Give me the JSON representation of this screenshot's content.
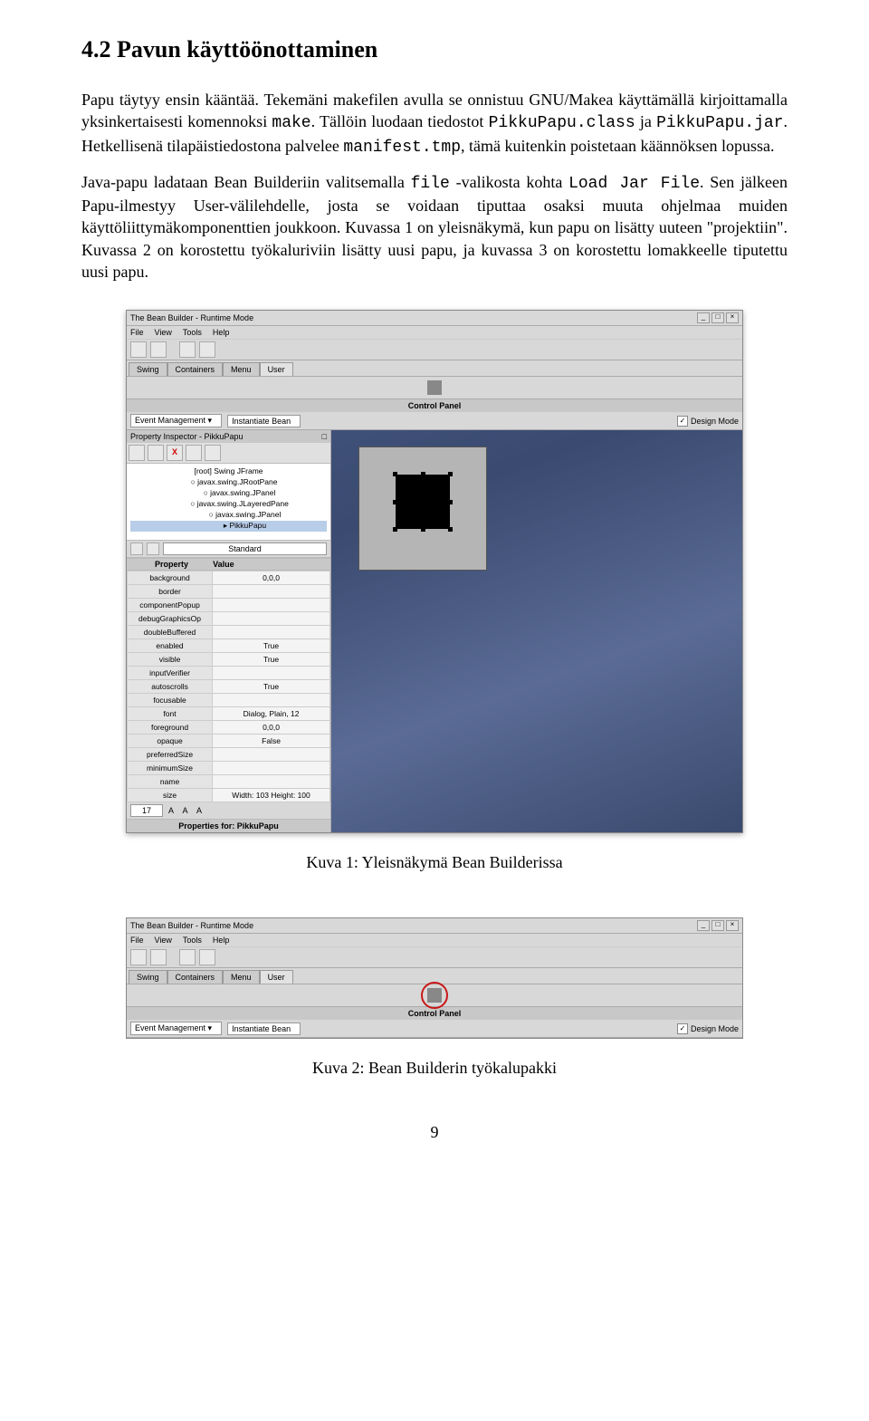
{
  "heading": "4.2   Pavun käyttöönottaminen",
  "para1_pre": "Papu täytyy ensin kääntää. Tekemäni makefilen avulla se onnistuu GNU/Makea käyttämällä kirjoittamalla yksinkertaisesti komennoksi ",
  "para1_code1": "make",
  "para1_mid1": ". Tällöin luodaan tiedostot ",
  "para1_code2": "PikkuPapu.class",
  "para1_mid2": " ja ",
  "para1_code3": "PikkuPapu.jar",
  "para1_mid3": ". Hetkellisenä tilapäistiedostona palvelee ",
  "para1_code4": "manifest.tmp",
  "para1_post": ", tämä kuitenkin poistetaan käännöksen lopussa.",
  "para2_pre": "Java-papu ladataan Bean Builderiin valitsemalla ",
  "para2_code1": "file",
  "para2_mid1": " -valikosta kohta ",
  "para2_code2": "Load Jar File",
  "para2_post": ". Sen jälkeen Papu-ilmestyy User-välilehdelle, josta se voidaan tiputtaa osaksi muuta ohjelmaa muiden käyttöliittymäkomponenttien joukkoon. Kuvassa 1 on yleisnäkymä, kun papu on lisätty uuteen \"projektiin\". Kuvassa 2 on korostettu työkaluriviin lisätty uusi papu, ja kuvassa 3 on korostettu lomakkeelle tiputettu uusi papu.",
  "caption1": "Kuva 1: Yleisnäkymä Bean Builderissa",
  "caption2": "Kuva 2: Bean Builderin työkalupakki",
  "page_number": "9",
  "window_title": "The Bean Builder - Runtime Mode",
  "menu": {
    "file": "File",
    "view": "View",
    "tools": "Tools",
    "help": "Help"
  },
  "tabs": {
    "swing": "Swing",
    "containers": "Containers",
    "menu": "Menu",
    "user": "User"
  },
  "control_panel": {
    "title": "Control Panel",
    "event_mgmt": "Event Management",
    "instantiate": "Instantiate Bean",
    "design_mode": "Design Mode"
  },
  "inspector": {
    "title": "Property Inspector - PikkuPapu",
    "tree_root": "[root] Swing JFrame",
    "tree_child1": "javax.swing.JRootPane",
    "tree_child2": "javax.swing.JPanel",
    "tree_child3": "javax.swing.JLayeredPane",
    "tree_child4": "javax.swing.JPanel",
    "tree_child5": "PikkuPapu",
    "prop_tab_dd": "Standard",
    "sect_property": "Property",
    "sect_value": "Value",
    "props": [
      {
        "k": "background",
        "v": "0,0,0"
      },
      {
        "k": "border",
        "v": ""
      },
      {
        "k": "componentPopup",
        "v": ""
      },
      {
        "k": "debugGraphicsOp",
        "v": ""
      },
      {
        "k": "doubleBuffered",
        "v": ""
      },
      {
        "k": "enabled",
        "v": "True"
      },
      {
        "k": "visible",
        "v": "True"
      },
      {
        "k": "inputVerifier",
        "v": ""
      },
      {
        "k": "autoscrolls",
        "v": "True"
      },
      {
        "k": "focusable",
        "v": ""
      },
      {
        "k": "font",
        "v": "Dialog, Plain, 12"
      },
      {
        "k": "foreground",
        "v": "0,0,0"
      },
      {
        "k": "opaque",
        "v": "False"
      },
      {
        "k": "preferredSize",
        "v": ""
      },
      {
        "k": "minimumSize",
        "v": ""
      },
      {
        "k": "name",
        "v": ""
      },
      {
        "k": "size",
        "v": "Width: 103    Height: 100"
      }
    ],
    "footer": "Properties for: PikkuPapu"
  },
  "spinner_a": "17",
  "spinner_font_glyphs": "A A A"
}
